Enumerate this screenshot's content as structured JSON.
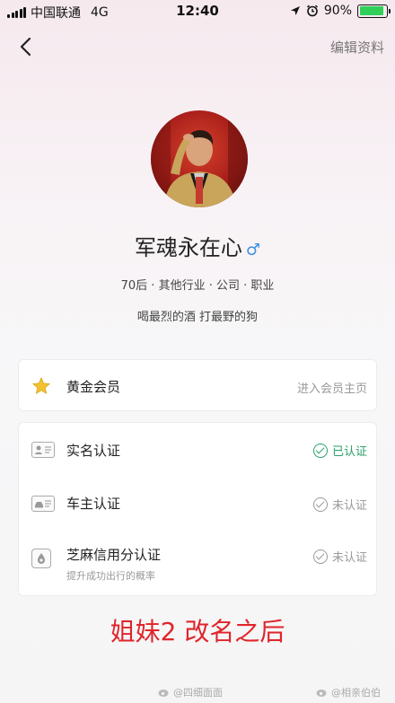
{
  "status_bar": {
    "carrier": "中国联通",
    "network": "4G",
    "time": "12:40",
    "battery": "90%",
    "battery_level": 0.9
  },
  "nav": {
    "edit_label": "编辑资料"
  },
  "profile": {
    "name": "军魂永在心",
    "gender_symbol": "♂",
    "tags": "70后 · 其他行业 · 公司 · 职业",
    "bio": "喝最烈的酒 打最野的狗"
  },
  "membership": {
    "label": "黄金会员",
    "action": "进入会员主页"
  },
  "verifications": [
    {
      "label": "实名认证",
      "status": "已认证",
      "verified": true
    },
    {
      "label": "车主认证",
      "status": "未认证",
      "verified": false
    },
    {
      "label": "芝麻信用分认证",
      "sublabel": "提升成功出行的概率",
      "status": "未认证",
      "verified": false
    }
  ],
  "caption": "姐妹2 改名之后",
  "watermarks": [
    "@四细面面",
    "@相亲伯伯"
  ],
  "colors": {
    "accent_green": "#2aa16a",
    "caption_red": "#e0252b",
    "gender_blue": "#3b8fe0",
    "star_gold": "#f2c230"
  }
}
